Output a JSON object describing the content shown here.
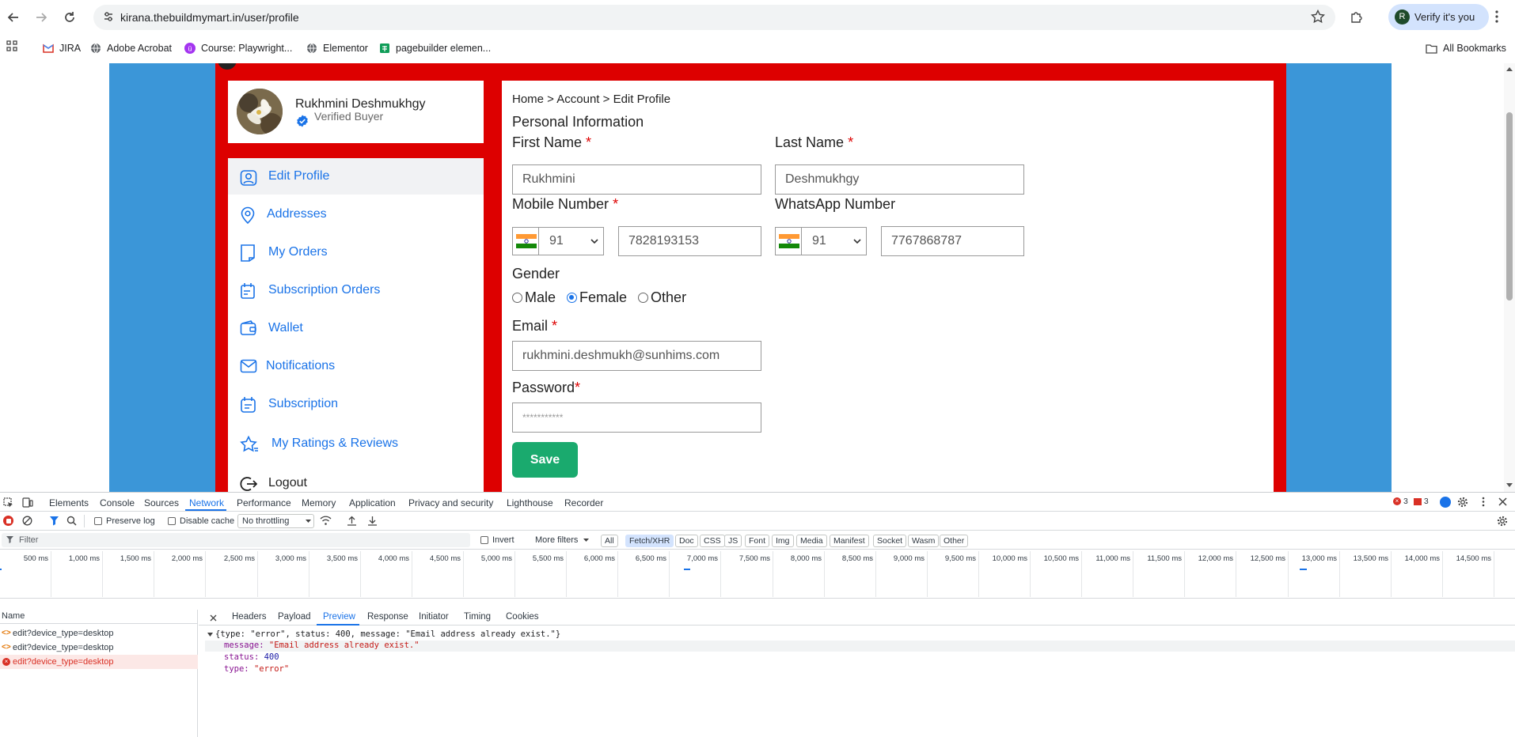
{
  "browser": {
    "url": "kirana.thebuildmymart.in/user/profile",
    "verify_label": "Verify it's you",
    "avatar_letter": "R",
    "bookmarks": [
      "JIRA",
      "Adobe Acrobat",
      "Course: Playwright...",
      "Elementor",
      "pagebuilder elemen..."
    ],
    "all_bookmarks": "All Bookmarks"
  },
  "profile": {
    "name": "Rukhmini Deshmukhgy",
    "status": "Verified Buyer"
  },
  "menu": [
    "Edit Profile",
    "Addresses",
    "My Orders",
    "Subscription Orders",
    "Wallet",
    "Notifications",
    "Subscription",
    "My Ratings & Reviews",
    "Logout"
  ],
  "form": {
    "breadcrumb": "Home > Account > Edit Profile",
    "section_title": "Personal Information",
    "first_name_label": "First Name",
    "first_name_value": "Rukhmini",
    "last_name_label": "Last Name",
    "last_name_value": "Deshmukhgy",
    "mobile_label": "Mobile Number",
    "mobile_code": "91",
    "mobile_value": "7828193153",
    "whatsapp_label": "WhatsApp Number",
    "whatsapp_code": "91",
    "whatsapp_value": "7767868787",
    "gender_label": "Gender",
    "gender_options": [
      "Male",
      "Female",
      "Other"
    ],
    "gender_selected": "Female",
    "email_label": "Email",
    "email_value": "rukhmini.deshmukh@sunhims.com",
    "password_label": "Password",
    "password_placeholder": "***********",
    "required_mark": "*",
    "save_label": "Save"
  },
  "devtools": {
    "tabs": [
      "Elements",
      "Console",
      "Sources",
      "Network",
      "Performance",
      "Memory",
      "Application",
      "Privacy and security",
      "Lighthouse",
      "Recorder"
    ],
    "active_tab": "Network",
    "error_count": "3",
    "warning_count": "3",
    "preserve_log": "Preserve log",
    "disable_cache": "Disable cache",
    "throttling": "No throttling",
    "filter_placeholder": "Filter",
    "invert": "Invert",
    "more_filters": "More filters",
    "type_filters": [
      "All",
      "Fetch/XHR",
      "Doc",
      "CSS",
      "JS",
      "Font",
      "Img",
      "Media",
      "Manifest",
      "Socket",
      "Wasm",
      "Other"
    ],
    "active_filter": "Fetch/XHR",
    "timeline_ticks": [
      "500 ms",
      "1,000 ms",
      "1,500 ms",
      "2,000 ms",
      "2,500 ms",
      "3,000 ms",
      "3,500 ms",
      "4,000 ms",
      "4,500 ms",
      "5,000 ms",
      "5,500 ms",
      "6,000 ms",
      "6,500 ms",
      "7,000 ms",
      "7,500 ms",
      "8,000 ms",
      "8,500 ms",
      "9,000 ms",
      "9,500 ms",
      "10,000 ms",
      "10,500 ms",
      "11,000 ms",
      "11,500 ms",
      "12,000 ms",
      "12,500 ms",
      "13,000 ms",
      "13,500 ms",
      "14,000 ms",
      "14,500 ms"
    ],
    "name_header": "Name",
    "requests": [
      {
        "name": "edit?device_type=desktop",
        "status": "ok"
      },
      {
        "name": "edit?device_type=desktop",
        "status": "ok"
      },
      {
        "name": "edit?device_type=desktop",
        "status": "error"
      }
    ],
    "detail_tabs": [
      "Headers",
      "Payload",
      "Preview",
      "Response",
      "Initiator",
      "Timing",
      "Cookies"
    ],
    "active_detail_tab": "Preview",
    "preview_summary": "{type: \"error\", status: 400, message: \"Email address already exist.\"}",
    "preview_lines": [
      {
        "key": "message",
        "value": "\"Email address already exist.\""
      },
      {
        "key": "status",
        "value": "400"
      },
      {
        "key": "type",
        "value": "\"error\""
      }
    ]
  },
  "colors": {
    "page_blue": "#3b96d8",
    "page_red": "#dd0000",
    "accent": "#1a73e8",
    "save_green": "#1aaa6e"
  }
}
